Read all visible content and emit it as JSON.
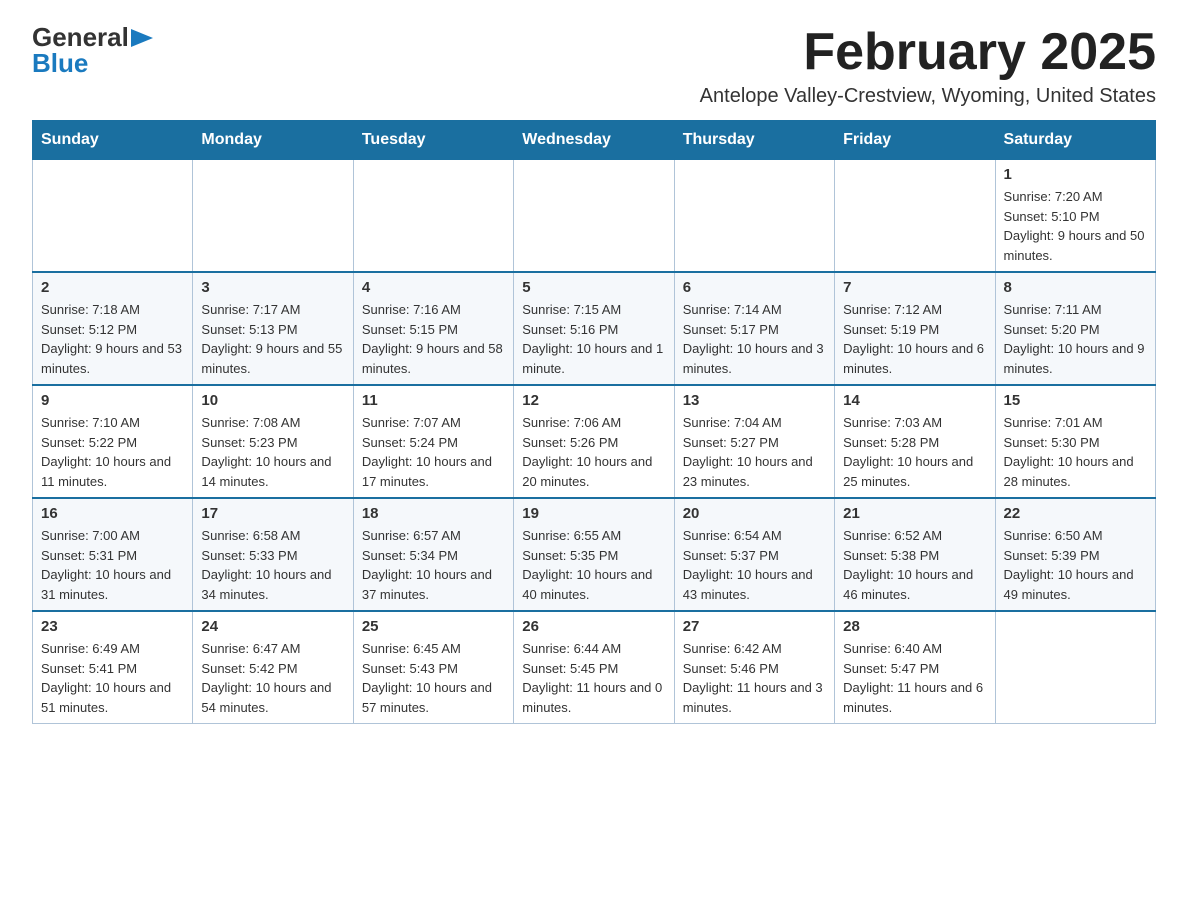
{
  "header": {
    "logo": {
      "general": "General",
      "blue": "Blue",
      "arrow": "▶"
    },
    "title": "February 2025",
    "location": "Antelope Valley-Crestview, Wyoming, United States"
  },
  "calendar": {
    "days_of_week": [
      "Sunday",
      "Monday",
      "Tuesday",
      "Wednesday",
      "Thursday",
      "Friday",
      "Saturday"
    ],
    "weeks": [
      [
        {
          "day": "",
          "info": ""
        },
        {
          "day": "",
          "info": ""
        },
        {
          "day": "",
          "info": ""
        },
        {
          "day": "",
          "info": ""
        },
        {
          "day": "",
          "info": ""
        },
        {
          "day": "",
          "info": ""
        },
        {
          "day": "1",
          "sunrise": "Sunrise: 7:20 AM",
          "sunset": "Sunset: 5:10 PM",
          "daylight": "Daylight: 9 hours and 50 minutes."
        }
      ],
      [
        {
          "day": "2",
          "sunrise": "Sunrise: 7:18 AM",
          "sunset": "Sunset: 5:12 PM",
          "daylight": "Daylight: 9 hours and 53 minutes."
        },
        {
          "day": "3",
          "sunrise": "Sunrise: 7:17 AM",
          "sunset": "Sunset: 5:13 PM",
          "daylight": "Daylight: 9 hours and 55 minutes."
        },
        {
          "day": "4",
          "sunrise": "Sunrise: 7:16 AM",
          "sunset": "Sunset: 5:15 PM",
          "daylight": "Daylight: 9 hours and 58 minutes."
        },
        {
          "day": "5",
          "sunrise": "Sunrise: 7:15 AM",
          "sunset": "Sunset: 5:16 PM",
          "daylight": "Daylight: 10 hours and 1 minute."
        },
        {
          "day": "6",
          "sunrise": "Sunrise: 7:14 AM",
          "sunset": "Sunset: 5:17 PM",
          "daylight": "Daylight: 10 hours and 3 minutes."
        },
        {
          "day": "7",
          "sunrise": "Sunrise: 7:12 AM",
          "sunset": "Sunset: 5:19 PM",
          "daylight": "Daylight: 10 hours and 6 minutes."
        },
        {
          "day": "8",
          "sunrise": "Sunrise: 7:11 AM",
          "sunset": "Sunset: 5:20 PM",
          "daylight": "Daylight: 10 hours and 9 minutes."
        }
      ],
      [
        {
          "day": "9",
          "sunrise": "Sunrise: 7:10 AM",
          "sunset": "Sunset: 5:22 PM",
          "daylight": "Daylight: 10 hours and 11 minutes."
        },
        {
          "day": "10",
          "sunrise": "Sunrise: 7:08 AM",
          "sunset": "Sunset: 5:23 PM",
          "daylight": "Daylight: 10 hours and 14 minutes."
        },
        {
          "day": "11",
          "sunrise": "Sunrise: 7:07 AM",
          "sunset": "Sunset: 5:24 PM",
          "daylight": "Daylight: 10 hours and 17 minutes."
        },
        {
          "day": "12",
          "sunrise": "Sunrise: 7:06 AM",
          "sunset": "Sunset: 5:26 PM",
          "daylight": "Daylight: 10 hours and 20 minutes."
        },
        {
          "day": "13",
          "sunrise": "Sunrise: 7:04 AM",
          "sunset": "Sunset: 5:27 PM",
          "daylight": "Daylight: 10 hours and 23 minutes."
        },
        {
          "day": "14",
          "sunrise": "Sunrise: 7:03 AM",
          "sunset": "Sunset: 5:28 PM",
          "daylight": "Daylight: 10 hours and 25 minutes."
        },
        {
          "day": "15",
          "sunrise": "Sunrise: 7:01 AM",
          "sunset": "Sunset: 5:30 PM",
          "daylight": "Daylight: 10 hours and 28 minutes."
        }
      ],
      [
        {
          "day": "16",
          "sunrise": "Sunrise: 7:00 AM",
          "sunset": "Sunset: 5:31 PM",
          "daylight": "Daylight: 10 hours and 31 minutes."
        },
        {
          "day": "17",
          "sunrise": "Sunrise: 6:58 AM",
          "sunset": "Sunset: 5:33 PM",
          "daylight": "Daylight: 10 hours and 34 minutes."
        },
        {
          "day": "18",
          "sunrise": "Sunrise: 6:57 AM",
          "sunset": "Sunset: 5:34 PM",
          "daylight": "Daylight: 10 hours and 37 minutes."
        },
        {
          "day": "19",
          "sunrise": "Sunrise: 6:55 AM",
          "sunset": "Sunset: 5:35 PM",
          "daylight": "Daylight: 10 hours and 40 minutes."
        },
        {
          "day": "20",
          "sunrise": "Sunrise: 6:54 AM",
          "sunset": "Sunset: 5:37 PM",
          "daylight": "Daylight: 10 hours and 43 minutes."
        },
        {
          "day": "21",
          "sunrise": "Sunrise: 6:52 AM",
          "sunset": "Sunset: 5:38 PM",
          "daylight": "Daylight: 10 hours and 46 minutes."
        },
        {
          "day": "22",
          "sunrise": "Sunrise: 6:50 AM",
          "sunset": "Sunset: 5:39 PM",
          "daylight": "Daylight: 10 hours and 49 minutes."
        }
      ],
      [
        {
          "day": "23",
          "sunrise": "Sunrise: 6:49 AM",
          "sunset": "Sunset: 5:41 PM",
          "daylight": "Daylight: 10 hours and 51 minutes."
        },
        {
          "day": "24",
          "sunrise": "Sunrise: 6:47 AM",
          "sunset": "Sunset: 5:42 PM",
          "daylight": "Daylight: 10 hours and 54 minutes."
        },
        {
          "day": "25",
          "sunrise": "Sunrise: 6:45 AM",
          "sunset": "Sunset: 5:43 PM",
          "daylight": "Daylight: 10 hours and 57 minutes."
        },
        {
          "day": "26",
          "sunrise": "Sunrise: 6:44 AM",
          "sunset": "Sunset: 5:45 PM",
          "daylight": "Daylight: 11 hours and 0 minutes."
        },
        {
          "day": "27",
          "sunrise": "Sunrise: 6:42 AM",
          "sunset": "Sunset: 5:46 PM",
          "daylight": "Daylight: 11 hours and 3 minutes."
        },
        {
          "day": "28",
          "sunrise": "Sunrise: 6:40 AM",
          "sunset": "Sunset: 5:47 PM",
          "daylight": "Daylight: 11 hours and 6 minutes."
        },
        {
          "day": "",
          "sunrise": "",
          "sunset": "",
          "daylight": ""
        }
      ]
    ]
  }
}
